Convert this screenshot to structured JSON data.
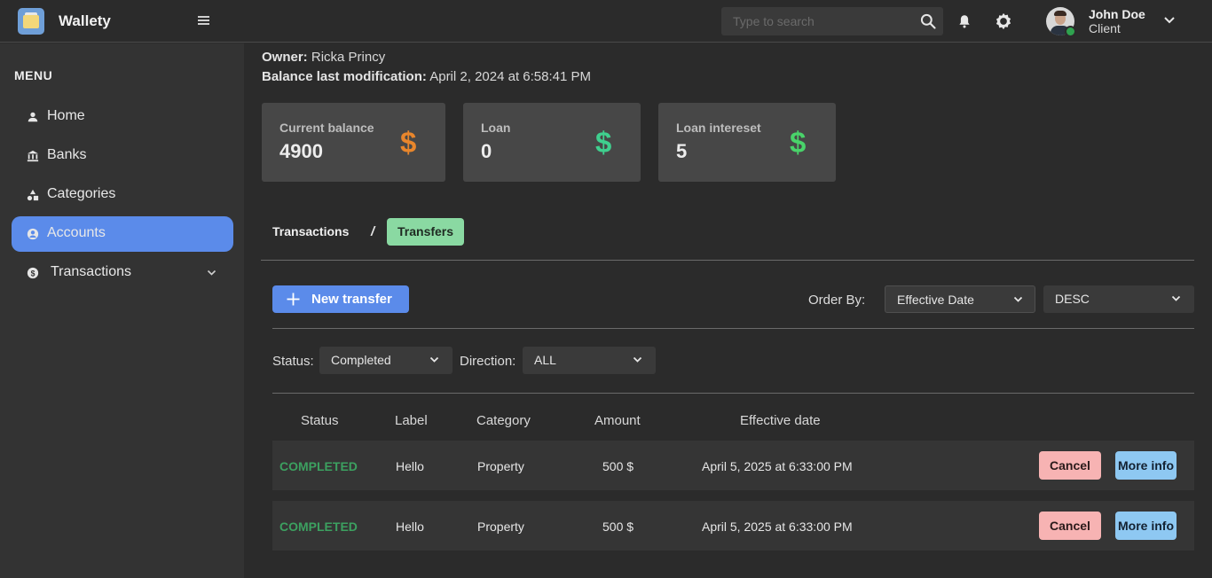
{
  "app": {
    "name": "Wallety"
  },
  "header": {
    "search_placeholder": "Type to search",
    "user": {
      "name": "John Doe",
      "role": "Client"
    }
  },
  "sidebar": {
    "title": "MENU",
    "items": [
      {
        "label": "Home",
        "icon": "person-icon"
      },
      {
        "label": "Banks",
        "icon": "bank-icon"
      },
      {
        "label": "Categories",
        "icon": "shapes-icon"
      },
      {
        "label": "Accounts",
        "icon": "account-circle-icon",
        "active": true
      },
      {
        "label": "Transactions",
        "icon": "dollar-coin-icon",
        "expandable": true
      }
    ]
  },
  "account": {
    "owner_label": "Owner:",
    "owner": "Ricka Princy",
    "modified_label": "Balance last modification:",
    "modified": "April 2, 2024 at 6:58:41 PM"
  },
  "cards": [
    {
      "label": "Current balance",
      "value": "4900",
      "symbol": "$",
      "color": "#e8862c"
    },
    {
      "label": "Loan",
      "value": "0",
      "symbol": "$",
      "color": "#3fcf8e"
    },
    {
      "label": "Loan intereset",
      "value": "5",
      "symbol": "$",
      "color": "#49d36a"
    }
  ],
  "tabs": {
    "transactions": "Transactions",
    "separator": "/",
    "transfers": "Transfers",
    "active": "Transfers"
  },
  "toolbar": {
    "new_transfer": "New transfer",
    "order_by_label": "Order By:",
    "order_by": "Effective Date",
    "order_dir": "DESC"
  },
  "filters": {
    "status_label": "Status:",
    "status": "Completed",
    "direction_label": "Direction:",
    "direction": "ALL"
  },
  "table": {
    "columns": [
      "Status",
      "Label",
      "Category",
      "Amount",
      "Effective date"
    ],
    "rows": [
      {
        "status": "COMPLETED",
        "label": "Hello",
        "category": "Property",
        "amount": "500 $",
        "date": "April 5, 2025 at 6:33:00 PM",
        "cancel": "Cancel",
        "more": "More info"
      },
      {
        "status": "COMPLETED",
        "label": "Hello",
        "category": "Property",
        "amount": "500 $",
        "date": "April 5, 2025 at 6:33:00 PM",
        "cancel": "Cancel",
        "more": "More info"
      }
    ]
  },
  "colors": {
    "accent": "#5b8bea",
    "completed": "#3ca060",
    "cancel_bg": "#f7b3b3",
    "more_bg": "#8ec8f2",
    "tab_active_bg": "#8ad9a2"
  }
}
